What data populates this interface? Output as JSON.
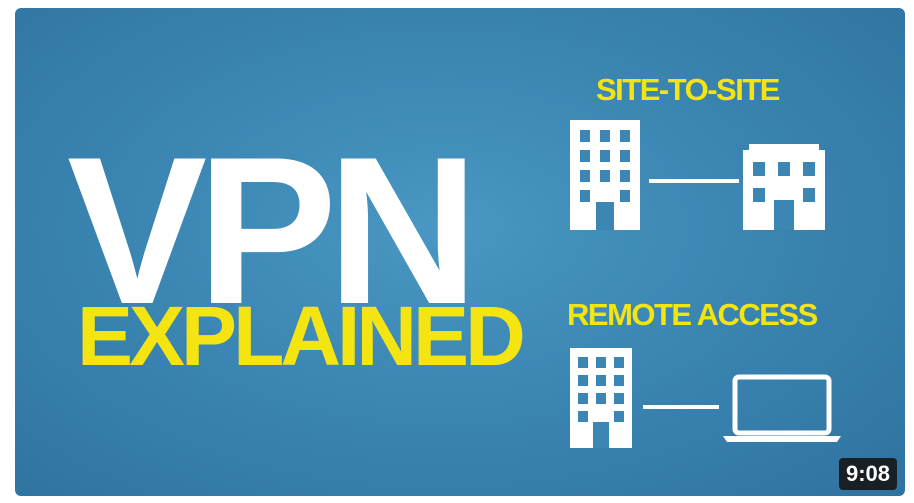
{
  "thumbnail": {
    "title_main": "VPN",
    "title_sub": "EXPLAINED",
    "site_to_site_label": "SITE-TO-SITE",
    "remote_access_label": "REMOTE ACCESS",
    "duration": "9:08",
    "icons": {
      "site_building_left": "office-building-icon",
      "site_building_right": "office-building-icon",
      "remote_building": "office-building-icon",
      "remote_laptop": "laptop-icon",
      "connection": "connection-line"
    }
  },
  "colors": {
    "background": "#3b86b3",
    "title_main": "#ffffff",
    "accent_yellow": "#f4e411",
    "duration_badge": "#141414"
  }
}
